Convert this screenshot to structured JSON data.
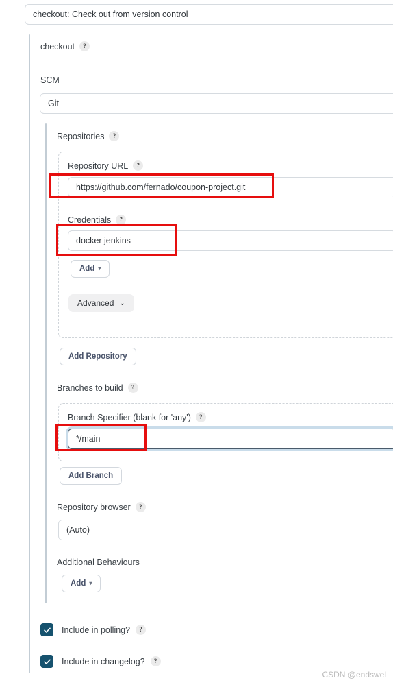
{
  "header": {
    "title": "checkout: Check out from version control"
  },
  "step": {
    "label": "checkout",
    "help": "?"
  },
  "scm": {
    "label": "SCM",
    "value": "Git"
  },
  "repositories": {
    "label": "Repositories",
    "help": "?",
    "repository_url": {
      "label": "Repository URL",
      "help": "?",
      "value": "https://github.com/fernado/coupon-project.git"
    },
    "credentials": {
      "label": "Credentials",
      "help": "?",
      "value": "docker jenkins"
    },
    "add_credentials_button": {
      "label": "Add",
      "caret": "▾"
    },
    "advanced_button": {
      "label": "Advanced",
      "chevron": "⌄"
    },
    "add_repository_button": {
      "label": "Add Repository"
    }
  },
  "branches": {
    "label": "Branches to build",
    "help": "?",
    "specifier": {
      "label": "Branch Specifier (blank for 'any')",
      "help": "?",
      "value": "*/main",
      "placeholder": ""
    },
    "add_branch_button": {
      "label": "Add Branch"
    }
  },
  "repository_browser": {
    "label": "Repository browser",
    "help": "?",
    "value": "(Auto)"
  },
  "additional_behaviours": {
    "label": "Additional Behaviours",
    "add_button": {
      "label": "Add",
      "caret": "▾"
    }
  },
  "options": [
    {
      "label": "Include in polling?",
      "help": "?",
      "checked": true
    },
    {
      "label": "Include in changelog?",
      "help": "?",
      "checked": true
    }
  ],
  "watermark": {
    "text": "CSDN @endswel"
  },
  "colors": {
    "annotation_red": "#e60e0e",
    "checkbox_navy": "#16526e",
    "border_gray": "#d6dbe0",
    "focus_ring": "#c9dcea"
  }
}
